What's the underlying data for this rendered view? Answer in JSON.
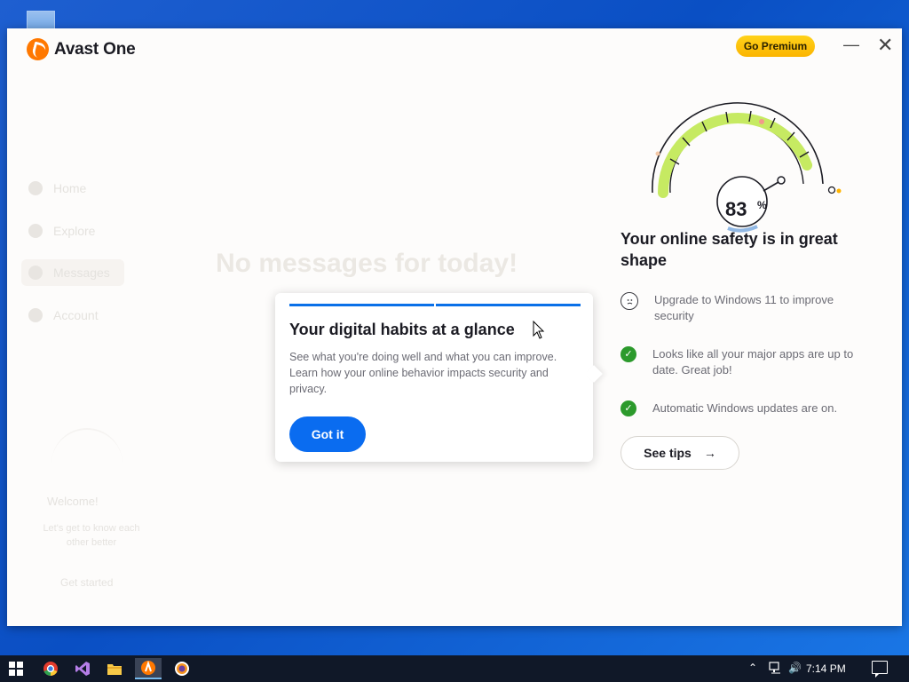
{
  "app": {
    "name": "Avast One",
    "premium_label": "Go Premium",
    "minimize_icon": "minimize-icon",
    "close_icon": "close-icon"
  },
  "background": {
    "sidebar_items": [
      "Home",
      "Explore",
      "Messages",
      "Account"
    ],
    "title": "No messages for today!",
    "welcome": "Welcome!",
    "welcome_sub": "Let's get to know each other better",
    "welcome_link": "Get started"
  },
  "popover": {
    "title": "Your digital habits at a glance",
    "text": "See what you're doing well and what you can improve. Learn how your online behavior impacts security and privacy.",
    "button": "Got it",
    "steps": 2
  },
  "gauge": {
    "value": "83",
    "unit": "%",
    "percent": 83,
    "fill_color": "#c6ea62",
    "stroke_color": "#1b1b23"
  },
  "safety": {
    "title": "Your online safety is in great shape",
    "items": [
      {
        "icon": "sad-face-icon",
        "text": "Upgrade to Windows 11 to improve security"
      },
      {
        "icon": "check-icon",
        "text": "Looks like all your major apps are up to date. Great job!"
      },
      {
        "icon": "check-icon",
        "text": "Automatic Windows updates are on."
      }
    ],
    "tips_button": "See tips"
  },
  "taskbar": {
    "time": "7:14 PM",
    "apps": [
      "chrome-icon",
      "visual-studio-icon",
      "file-explorer-icon",
      "avast-icon",
      "avast-browser-icon"
    ]
  }
}
